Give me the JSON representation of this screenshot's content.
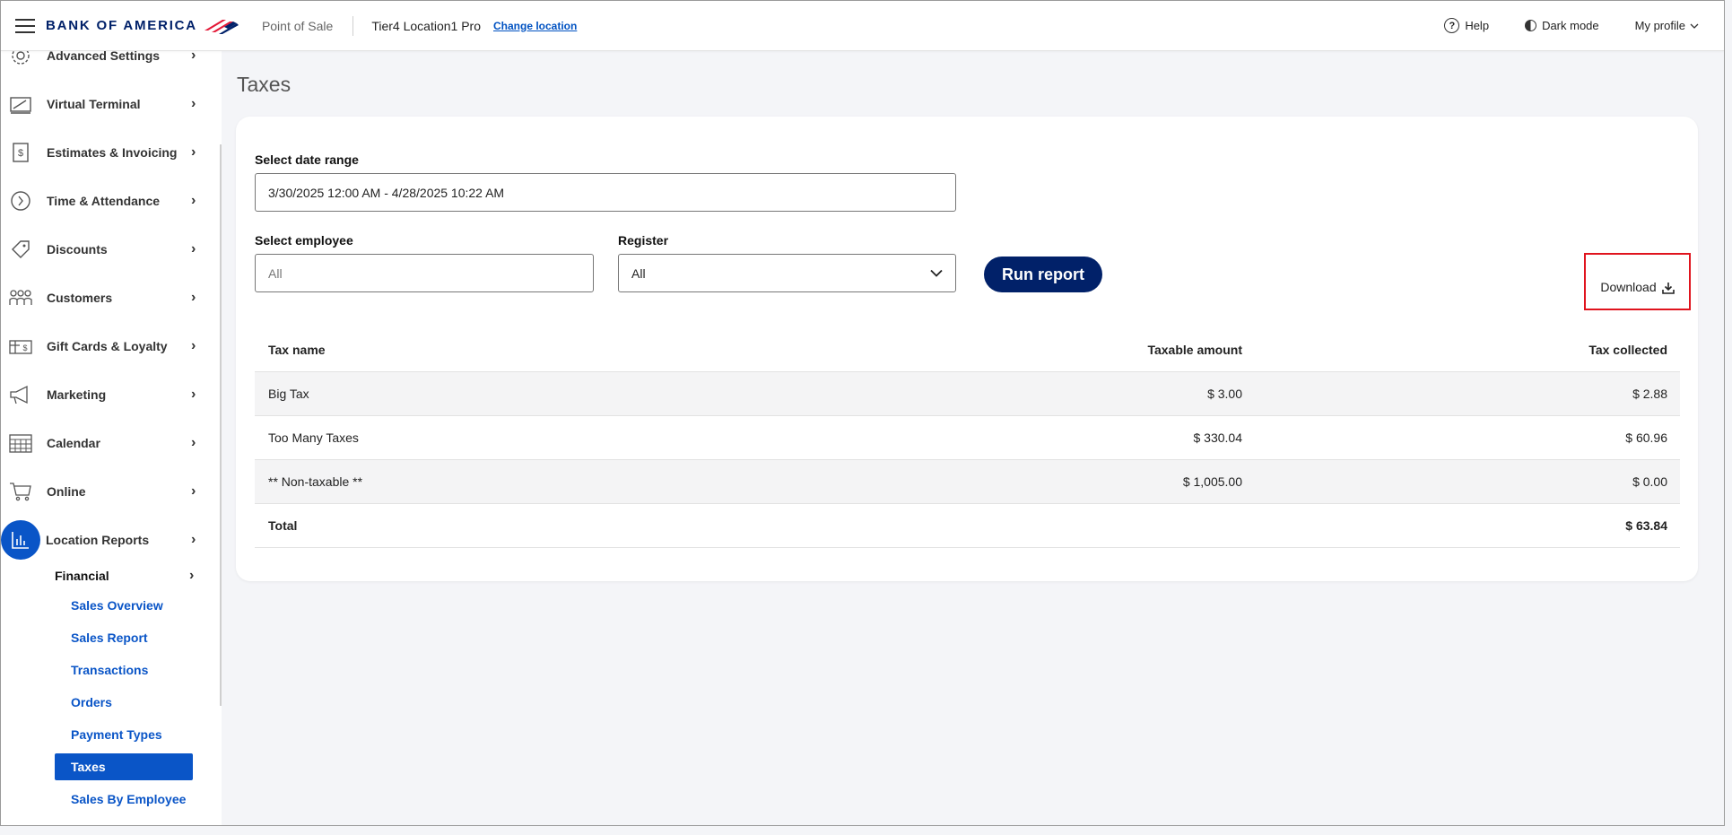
{
  "header": {
    "brand": "BANK OF AMERICA",
    "app_name": "Point of Sale",
    "location": "Tier4 Location1 Pro",
    "change_location": "Change location",
    "help": "Help",
    "dark_mode": "Dark mode",
    "profile": "My profile"
  },
  "sidebar": {
    "items": [
      {
        "label": "Advanced Settings",
        "icon": "gear-icon"
      },
      {
        "label": "Virtual Terminal",
        "icon": "terminal-icon"
      },
      {
        "label": "Estimates & Invoicing",
        "icon": "invoice-icon"
      },
      {
        "label": "Time & Attendance",
        "icon": "clock-icon"
      },
      {
        "label": "Discounts",
        "icon": "tag-icon"
      },
      {
        "label": "Customers",
        "icon": "people-icon"
      },
      {
        "label": "Gift Cards & Loyalty",
        "icon": "gift-card-icon"
      },
      {
        "label": "Marketing",
        "icon": "megaphone-icon"
      },
      {
        "label": "Calendar",
        "icon": "calendar-icon"
      },
      {
        "label": "Online",
        "icon": "cart-icon"
      },
      {
        "label": "Location Reports",
        "icon": "bar-chart-icon"
      }
    ],
    "submenu_title": "Financial",
    "submenu": [
      "Sales Overview",
      "Sales Report",
      "Transactions",
      "Orders",
      "Payment Types",
      "Taxes",
      "Sales By Employee"
    ],
    "active_item": "Location Reports",
    "selected_sub": "Taxes"
  },
  "main": {
    "title": "Taxes",
    "date_range_label": "Select date range",
    "date_range_value": "3/30/2025 12:00 AM - 4/28/2025 10:22 AM",
    "employee_label": "Select employee",
    "employee_placeholder": "All",
    "register_label": "Register",
    "register_value": "All",
    "run_report": "Run report",
    "download": "Download"
  },
  "table": {
    "headers": [
      "Tax name",
      "Taxable amount",
      "Tax collected"
    ],
    "rows": [
      {
        "name": "Big Tax",
        "taxable": "$ 3.00",
        "collected": "$ 2.88"
      },
      {
        "name": "Too Many Taxes",
        "taxable": "$ 330.04",
        "collected": "$ 60.96"
      },
      {
        "name": "** Non-taxable **",
        "taxable": "$ 1,005.00",
        "collected": "$ 0.00"
      }
    ],
    "total": {
      "label": "Total",
      "collected": "$ 63.84"
    }
  },
  "colors": {
    "brand_navy": "#012169",
    "accent_blue": "#0a55c7",
    "highlight_red": "#e0141e"
  }
}
